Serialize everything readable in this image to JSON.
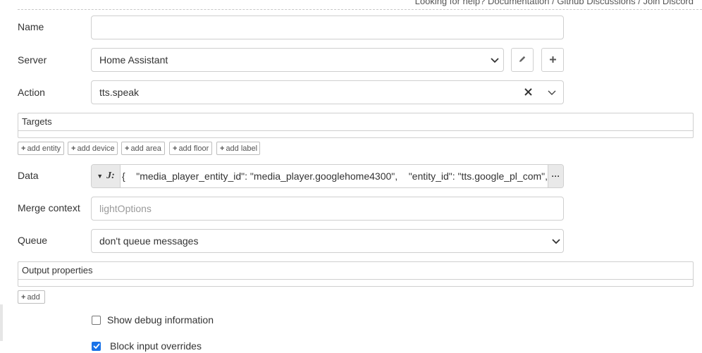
{
  "help": {
    "prefix": "Looking for help?",
    "links": [
      "Documentation",
      "Github Discussions",
      "Join Discord"
    ],
    "separator": "/"
  },
  "fields": {
    "name": {
      "label": "Name",
      "value": ""
    },
    "server": {
      "label": "Server",
      "value": "Home Assistant"
    },
    "action": {
      "label": "Action",
      "value": "tts.speak"
    },
    "targets": {
      "title": "Targets",
      "buttons": [
        "add entity",
        "add device",
        "add area",
        "add floor",
        "add label"
      ]
    },
    "data": {
      "label": "Data",
      "value": "{    \"media_player_entity_id\": \"media_player.googlehome4300\",    \"entity_id\": \"tts.google_pl_com\","
    },
    "merge_context": {
      "label": "Merge context",
      "placeholder": "lightOptions"
    },
    "queue": {
      "label": "Queue",
      "value": "don't queue messages"
    },
    "output": {
      "title": "Output properties",
      "add_label": "add"
    }
  },
  "options": {
    "debug": {
      "label": "Show debug information",
      "checked": false
    },
    "block": {
      "label": "Block input overrides",
      "checked": true
    }
  },
  "colors": {
    "checkbox_accent": "#1a73e8",
    "border": "#cfcfcf"
  }
}
